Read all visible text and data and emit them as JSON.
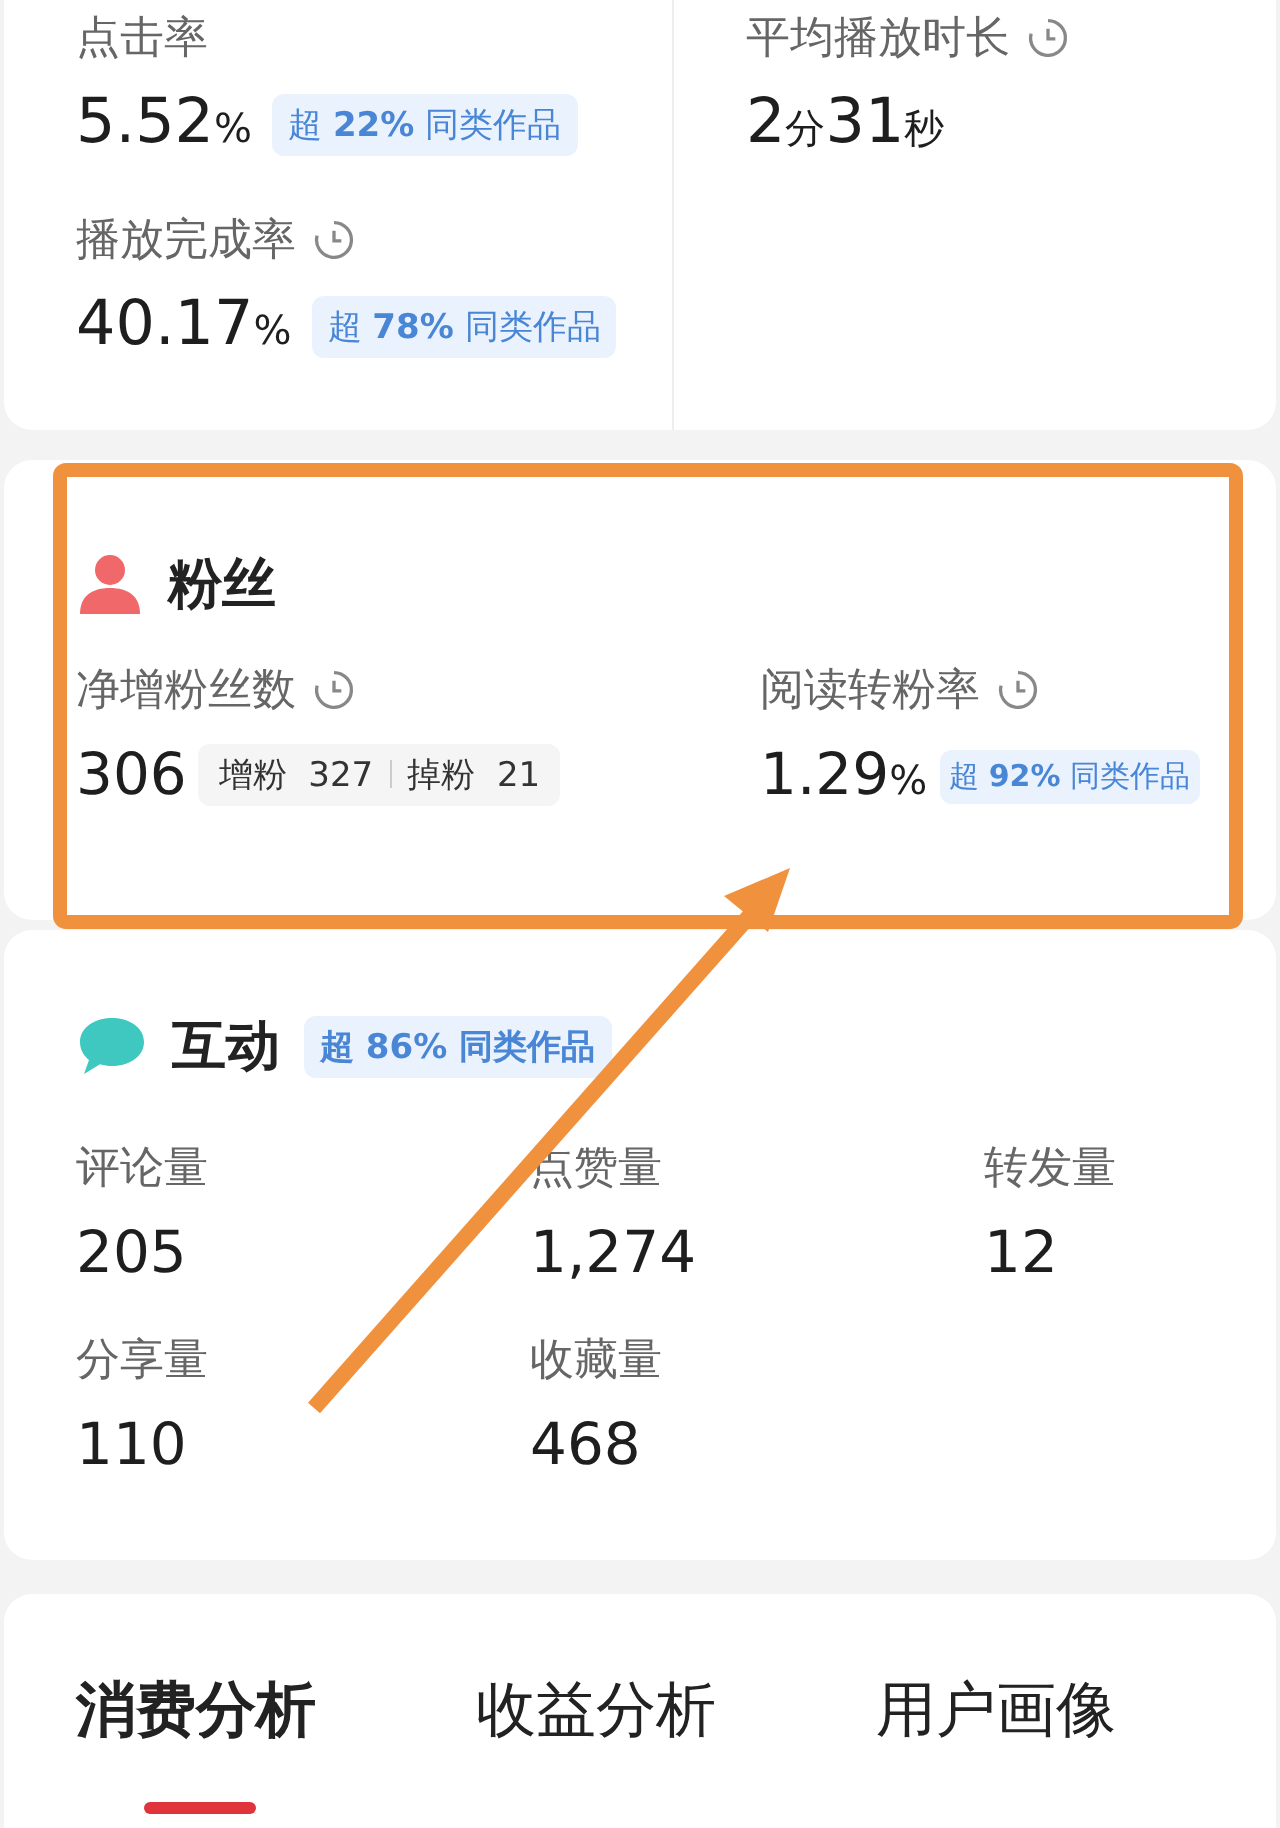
{
  "overview": {
    "metrics": [
      {
        "label": "点击率",
        "clock": false,
        "value": [
          {
            "kind": "num",
            "text": "5.52"
          },
          {
            "kind": "unit",
            "text": "%"
          }
        ],
        "badge": "超 **22%** 同类作品"
      },
      {
        "label": "平均播放时长",
        "clock": true,
        "value": [
          {
            "kind": "num",
            "text": "2"
          },
          {
            "kind": "unit",
            "text": "分"
          },
          {
            "kind": "num",
            "text": "31"
          },
          {
            "kind": "unit",
            "text": "秒"
          }
        ]
      },
      {
        "label": "播放完成率",
        "clock": true,
        "value": [
          {
            "kind": "num",
            "text": "40.17"
          },
          {
            "kind": "unit",
            "text": "%"
          }
        ],
        "badge": "超 **78%** 同类作品"
      }
    ]
  },
  "fans": {
    "title": "粉丝",
    "metrics": [
      {
        "label": "净增粉丝数",
        "clock": true,
        "value": [
          {
            "kind": "num",
            "text": "306"
          }
        ],
        "breakdown": [
          {
            "label": "增粉",
            "value": "327"
          },
          {
            "label": "掉粉",
            "value": "21"
          }
        ]
      },
      {
        "label": "阅读转粉率",
        "clock": true,
        "value": [
          {
            "kind": "num",
            "text": "1.29"
          },
          {
            "kind": "unit",
            "text": "%"
          }
        ],
        "badge": "超 **92%** 同类作品"
      }
    ]
  },
  "interaction": {
    "title": "互动",
    "badge": "超 **86%** 同类作品",
    "metrics": [
      {
        "label": "评论量",
        "value": "205"
      },
      {
        "label": "点赞量",
        "value": "1,274"
      },
      {
        "label": "转发量",
        "value": "12"
      },
      {
        "label": "分享量",
        "value": "110"
      },
      {
        "label": "收藏量",
        "value": "468"
      }
    ]
  },
  "tabs": [
    {
      "label": "消费分析",
      "selected": true
    },
    {
      "label": "收益分析",
      "selected": false
    },
    {
      "label": "用户画像",
      "selected": false
    }
  ]
}
